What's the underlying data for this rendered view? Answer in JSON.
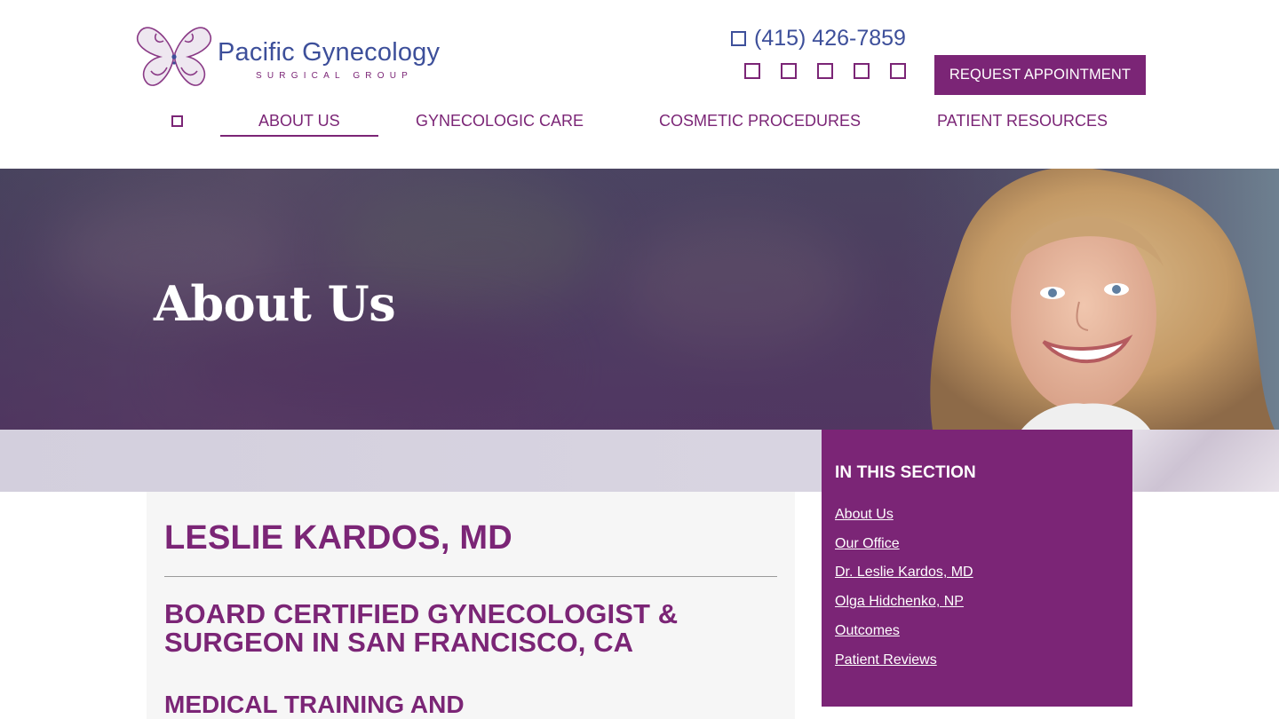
{
  "brand": {
    "name": "Pacific Gynecology",
    "tagline": "SURGICAL GROUP",
    "primary_color": "#7b2576",
    "secondary_color": "#3d4f9a"
  },
  "header": {
    "phone_icon": "phone-icon",
    "phone": "(415) 426-7859",
    "social_icons": [
      "facebook-icon",
      "twitter-icon",
      "instagram-icon",
      "youtube-icon",
      "linkedin-icon"
    ],
    "request_button": "REQUEST APPOINTMENT"
  },
  "nav": {
    "home_icon": "home-icon",
    "items": [
      {
        "label": "ABOUT US",
        "active": true
      },
      {
        "label": "GYNECOLOGIC CARE",
        "active": false
      },
      {
        "label": "COSMETIC PROCEDURES",
        "active": false
      },
      {
        "label": "PATIENT RESOURCES",
        "active": false
      }
    ]
  },
  "hero": {
    "title": "About Us"
  },
  "main": {
    "name": "LESLIE KARDOS, MD",
    "subheading": "BOARD CERTIFIED GYNECOLOGIST & SURGEON IN SAN FRANCISCO, CA",
    "section_heading": "MEDICAL TRAINING AND"
  },
  "sidebar": {
    "title": "IN THIS SECTION",
    "links": [
      "About Us",
      "Our Office",
      "Dr. Leslie Kardos, MD",
      "Olga Hidchenko, NP",
      "Outcomes",
      "Patient Reviews"
    ]
  }
}
